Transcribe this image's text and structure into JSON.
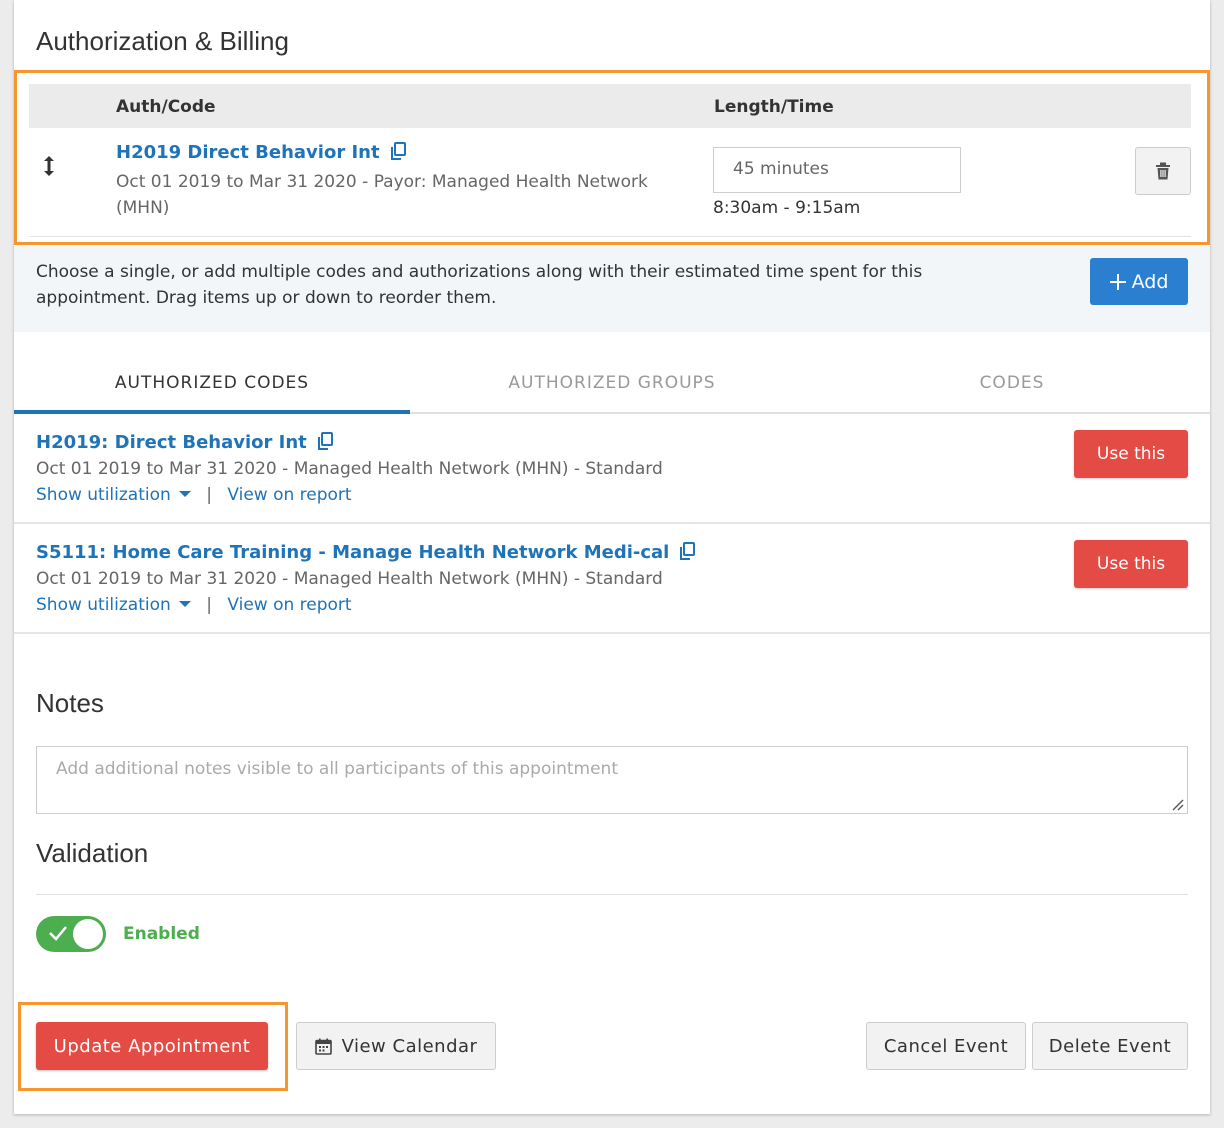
{
  "auth_billing": {
    "title": "Authorization & Billing",
    "col_auth": "Auth/Code",
    "col_length": "Length/Time",
    "entry": {
      "code": "H2019 Direct Behavior Int",
      "details_line1": "Oct 01 2019 to Mar 31 2020 - Payor: Managed Health Network",
      "details_line2": "(MHN)",
      "length": "45 minutes",
      "time_range": "8:30am - 9:15am"
    },
    "hint": "Choose a single, or add multiple codes and authorizations along with their estimated time spent for this appointment. Drag items up or down to reorder them.",
    "add_label": "Add"
  },
  "tabs": [
    {
      "label": "AUTHORIZED CODES",
      "active": true
    },
    {
      "label": "AUTHORIZED GROUPS",
      "active": false
    },
    {
      "label": "CODES",
      "active": false
    }
  ],
  "codes": [
    {
      "title": "H2019: Direct Behavior Int",
      "details": "Oct 01 2019 to Mar 31 2020 - Managed Health Network (MHN) - Standard",
      "show_util": "Show utilization",
      "view_report": "View on report",
      "sep": "|",
      "use_label": "Use this"
    },
    {
      "title": "S5111: Home Care Training - Manage Health Network Medi-cal",
      "details": "Oct 01 2019 to Mar 31 2020 - Managed Health Network (MHN) - Standard",
      "show_util": "Show utilization",
      "view_report": "View on report",
      "sep": "|",
      "use_label": "Use this"
    }
  ],
  "notes": {
    "title": "Notes",
    "placeholder": "Add additional notes visible to all participants of this appointment"
  },
  "validation": {
    "title": "Validation",
    "toggle_label": "Enabled",
    "enabled": true
  },
  "actions": {
    "update": "Update Appointment",
    "view_calendar": "View Calendar",
    "cancel_event": "Cancel Event",
    "delete_event": "Delete Event"
  },
  "colors": {
    "accent_blue": "#1f73b7",
    "add_blue": "#2b7fd0",
    "danger_red": "#e54b45",
    "success_green": "#4cae4f",
    "highlight_orange": "#f5972e"
  }
}
